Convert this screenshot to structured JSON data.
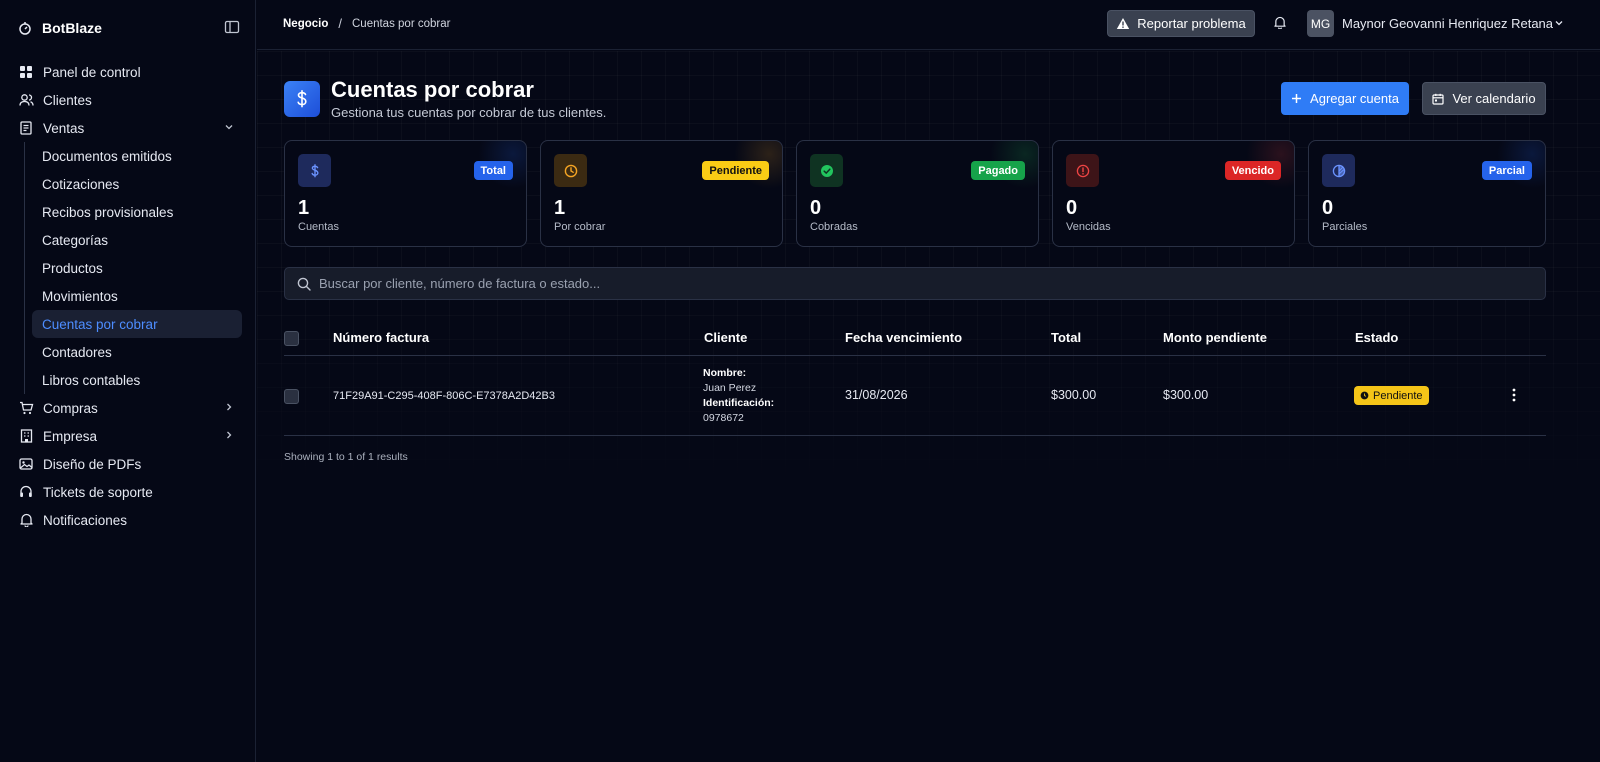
{
  "app": {
    "name": "BotBlaze"
  },
  "sidebar": {
    "items": [
      {
        "label": "Panel de control",
        "icon": "grid-icon"
      },
      {
        "label": "Clientes",
        "icon": "users-icon"
      },
      {
        "label": "Ventas",
        "icon": "receipt-icon",
        "expanded": true
      },
      {
        "label": "Compras",
        "icon": "cart-icon"
      },
      {
        "label": "Empresa",
        "icon": "building-icon"
      },
      {
        "label": "Diseño de PDFs",
        "icon": "image-icon"
      },
      {
        "label": "Tickets de soporte",
        "icon": "headset-icon"
      },
      {
        "label": "Notificaciones",
        "icon": "bell-icon"
      }
    ],
    "ventas_sub": [
      {
        "label": "Documentos emitidos"
      },
      {
        "label": "Cotizaciones"
      },
      {
        "label": "Recibos provisionales"
      },
      {
        "label": "Categorías"
      },
      {
        "label": "Productos"
      },
      {
        "label": "Movimientos"
      },
      {
        "label": "Cuentas por cobrar",
        "active": true
      },
      {
        "label": "Contadores"
      },
      {
        "label": "Libros contables"
      }
    ]
  },
  "topbar": {
    "breadcrumb": [
      "Negocio",
      "Cuentas por cobrar"
    ],
    "breadcrumb_sep": "/",
    "report_label": "Reportar problema",
    "user_initials": "MG",
    "user_name": "Maynor Geovanni Henriquez Retana"
  },
  "page": {
    "title": "Cuentas por cobrar",
    "subtitle": "Gestiona tus cuentas por cobrar de tus clientes.",
    "add_label": "Agregar cuenta",
    "calendar_label": "Ver calendario"
  },
  "stats": [
    {
      "badge": "Total",
      "value": "1",
      "label": "Cuentas",
      "icon": "dollar-icon",
      "badge_color": "#2563eb",
      "icon_bg": "#1e2a5c",
      "icon_color": "#6b93ff"
    },
    {
      "badge": "Pendiente",
      "value": "1",
      "label": "Por cobrar",
      "icon": "clock-icon",
      "badge_color": "#facc15",
      "icon_bg": "#3b2a12",
      "icon_color": "#f5a524"
    },
    {
      "badge": "Pagado",
      "value": "0",
      "label": "Cobradas",
      "icon": "check-circle-icon",
      "badge_color": "#16a34a",
      "icon_bg": "#0f3322",
      "icon_color": "#22c55e"
    },
    {
      "badge": "Vencido",
      "value": "0",
      "label": "Vencidas",
      "icon": "alert-circle-icon",
      "badge_color": "#dc2626",
      "icon_bg": "#3d1418",
      "icon_color": "#ef4444"
    },
    {
      "badge": "Parcial",
      "value": "0",
      "label": "Parciales",
      "icon": "half-circle-icon",
      "badge_color": "#2563eb",
      "icon_bg": "#1e2a5c",
      "icon_color": "#6b93ff"
    }
  ],
  "search": {
    "placeholder": "Buscar por cliente, número de factura o estado..."
  },
  "table": {
    "columns": [
      "Número factura",
      "Cliente",
      "Fecha vencimiento",
      "Total",
      "Monto pendiente",
      "Estado"
    ],
    "rows": [
      {
        "invoice": "71F29A91-C295-408F-806C-E7378A2D42B3",
        "client_name_label": "Nombre:",
        "client_name": "Juan Perez",
        "client_id_label": "Identificación:",
        "client_id": "0978672",
        "due_date": "31/08/2026",
        "total": "$300.00",
        "pending": "$300.00",
        "status": "Pendiente"
      }
    ],
    "footer": "Showing 1 to 1 of 1 results"
  }
}
